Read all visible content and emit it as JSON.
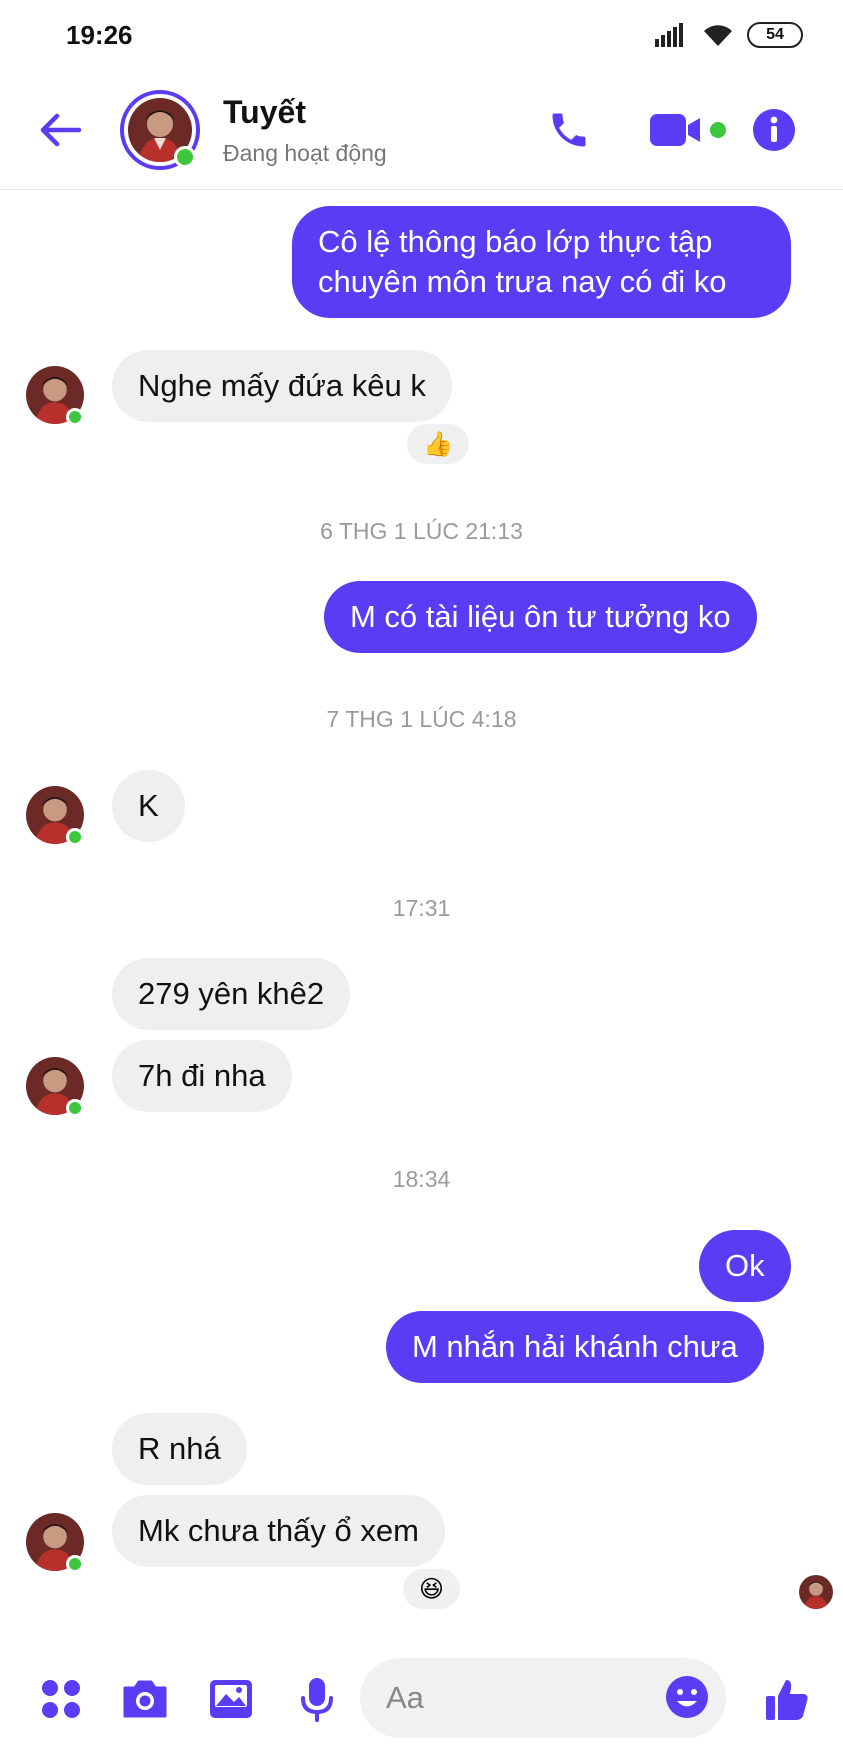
{
  "status_bar": {
    "time": "19:26",
    "battery": "54"
  },
  "header": {
    "contact_name": "Tuyết",
    "contact_status": "Đang hoạt động",
    "accent_color": "#5b3cf5",
    "online_color": "#3dc73d"
  },
  "messages": {
    "m1": {
      "line1": "Cô lệ thông báo lớp thực tập",
      "line2": "chuyên môn trưa nay có đi ko"
    },
    "m2": "Nghe mấy đứa kêu k",
    "m2_reaction": "👍",
    "ts1": "6 THG 1 LÚC 21:13",
    "m3": "M có tài liệu ôn tư tưởng ko",
    "ts2": "7 THG 1 LÚC 4:18",
    "m4": "K",
    "ts3": "17:31",
    "m5": "279 yên khê2",
    "m6": "7h đi nha",
    "ts4": "18:34",
    "m7": "Ok",
    "m8": "M nhắn hải khánh chưa",
    "m9": "R nhá",
    "m10": "Mk chưa thấy ổ xem",
    "m10_reaction": "😆"
  },
  "composer": {
    "placeholder": "Aa"
  },
  "icons": {
    "back": "arrow-left-icon",
    "call": "phone-icon",
    "video": "video-camera-icon",
    "info": "info-icon",
    "apps": "apps-grid-icon",
    "camera": "camera-icon",
    "gallery": "image-icon",
    "mic": "microphone-icon",
    "emoji": "emoji-icon",
    "like": "thumbs-up-icon"
  }
}
